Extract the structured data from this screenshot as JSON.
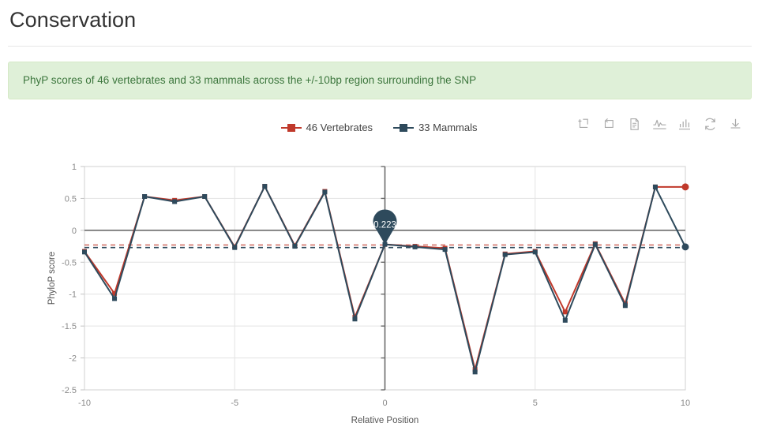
{
  "header": {
    "title": "Conservation"
  },
  "banner": {
    "text": "PhyP scores of 46 vertebrates and 33 mammals across the +/-10bp region surrounding the SNP",
    "bg_color": "#dff0d8",
    "text_color": "#3c763d"
  },
  "legend": [
    {
      "label": "46 Vertebrates",
      "color": "#c0392b"
    },
    {
      "label": "33 Mammals",
      "color": "#2e4a5c"
    }
  ],
  "toolbar": [
    {
      "name": "zoom-select-icon",
      "title": "Zoom area"
    },
    {
      "name": "zoom-restore-icon",
      "title": "Restore zoom"
    },
    {
      "name": "data-table-icon",
      "title": "Data table"
    },
    {
      "name": "line-chart-icon",
      "title": "Line chart"
    },
    {
      "name": "bar-chart-icon",
      "title": "Bar chart"
    },
    {
      "name": "refresh-icon",
      "title": "Refresh"
    },
    {
      "name": "download-icon",
      "title": "Download"
    }
  ],
  "tooltip": {
    "value": "0.223"
  },
  "chart_data": {
    "type": "line",
    "title": "",
    "xlabel": "Relative Position",
    "ylabel": "PhyloP score",
    "xlim": [
      -10,
      10
    ],
    "ylim": [
      -2.5,
      1
    ],
    "xticks": [
      -10,
      -5,
      0,
      5,
      10
    ],
    "yticks": [
      1,
      0.5,
      0,
      -0.5,
      -1,
      -1.5,
      -2,
      -2.5
    ],
    "ytick_labels": [
      "1",
      "0.5",
      "0",
      "-0.5",
      "-1",
      "-1.5",
      "-2",
      "-2.5"
    ],
    "xtick_labels": [
      "-10",
      "-5",
      "0",
      "5",
      "10"
    ],
    "grid": true,
    "legend_position": "top-center",
    "x": [
      -10,
      -9,
      -8,
      -7,
      -6,
      -5,
      -4,
      -3,
      -2,
      -1,
      0,
      1,
      2,
      3,
      4,
      5,
      6,
      7,
      8,
      9,
      10
    ],
    "series": [
      {
        "name": "46 Vertebrates",
        "color": "#c0392b",
        "values": [
          -0.33,
          -0.99,
          0.53,
          0.47,
          0.53,
          -0.26,
          0.69,
          -0.24,
          0.61,
          -1.36,
          -0.22,
          -0.25,
          -0.28,
          -2.18,
          -0.37,
          -0.33,
          -1.28,
          -0.21,
          -1.15,
          0.68,
          0.68
        ]
      },
      {
        "name": "33 Mammals",
        "color": "#2e4a5c",
        "values": [
          -0.34,
          -1.07,
          0.53,
          0.45,
          0.53,
          -0.27,
          0.69,
          -0.25,
          0.6,
          -1.39,
          -0.22,
          -0.26,
          -0.3,
          -2.22,
          -0.38,
          -0.34,
          -1.41,
          -0.22,
          -1.18,
          0.68,
          -0.26
        ]
      }
    ],
    "reference_lines": [
      {
        "name": "vertebrates-mean",
        "value": -0.23,
        "color": "#c0392b",
        "style": "dashed"
      },
      {
        "name": "mammals-mean",
        "value": -0.27,
        "color": "#2e4a5c",
        "style": "dashed"
      }
    ],
    "zero_line": {
      "value": 0,
      "color": "#6b6b6b"
    },
    "snp_marker": {
      "x": 0,
      "value": 0.223,
      "color": "#2e4a5c"
    }
  }
}
